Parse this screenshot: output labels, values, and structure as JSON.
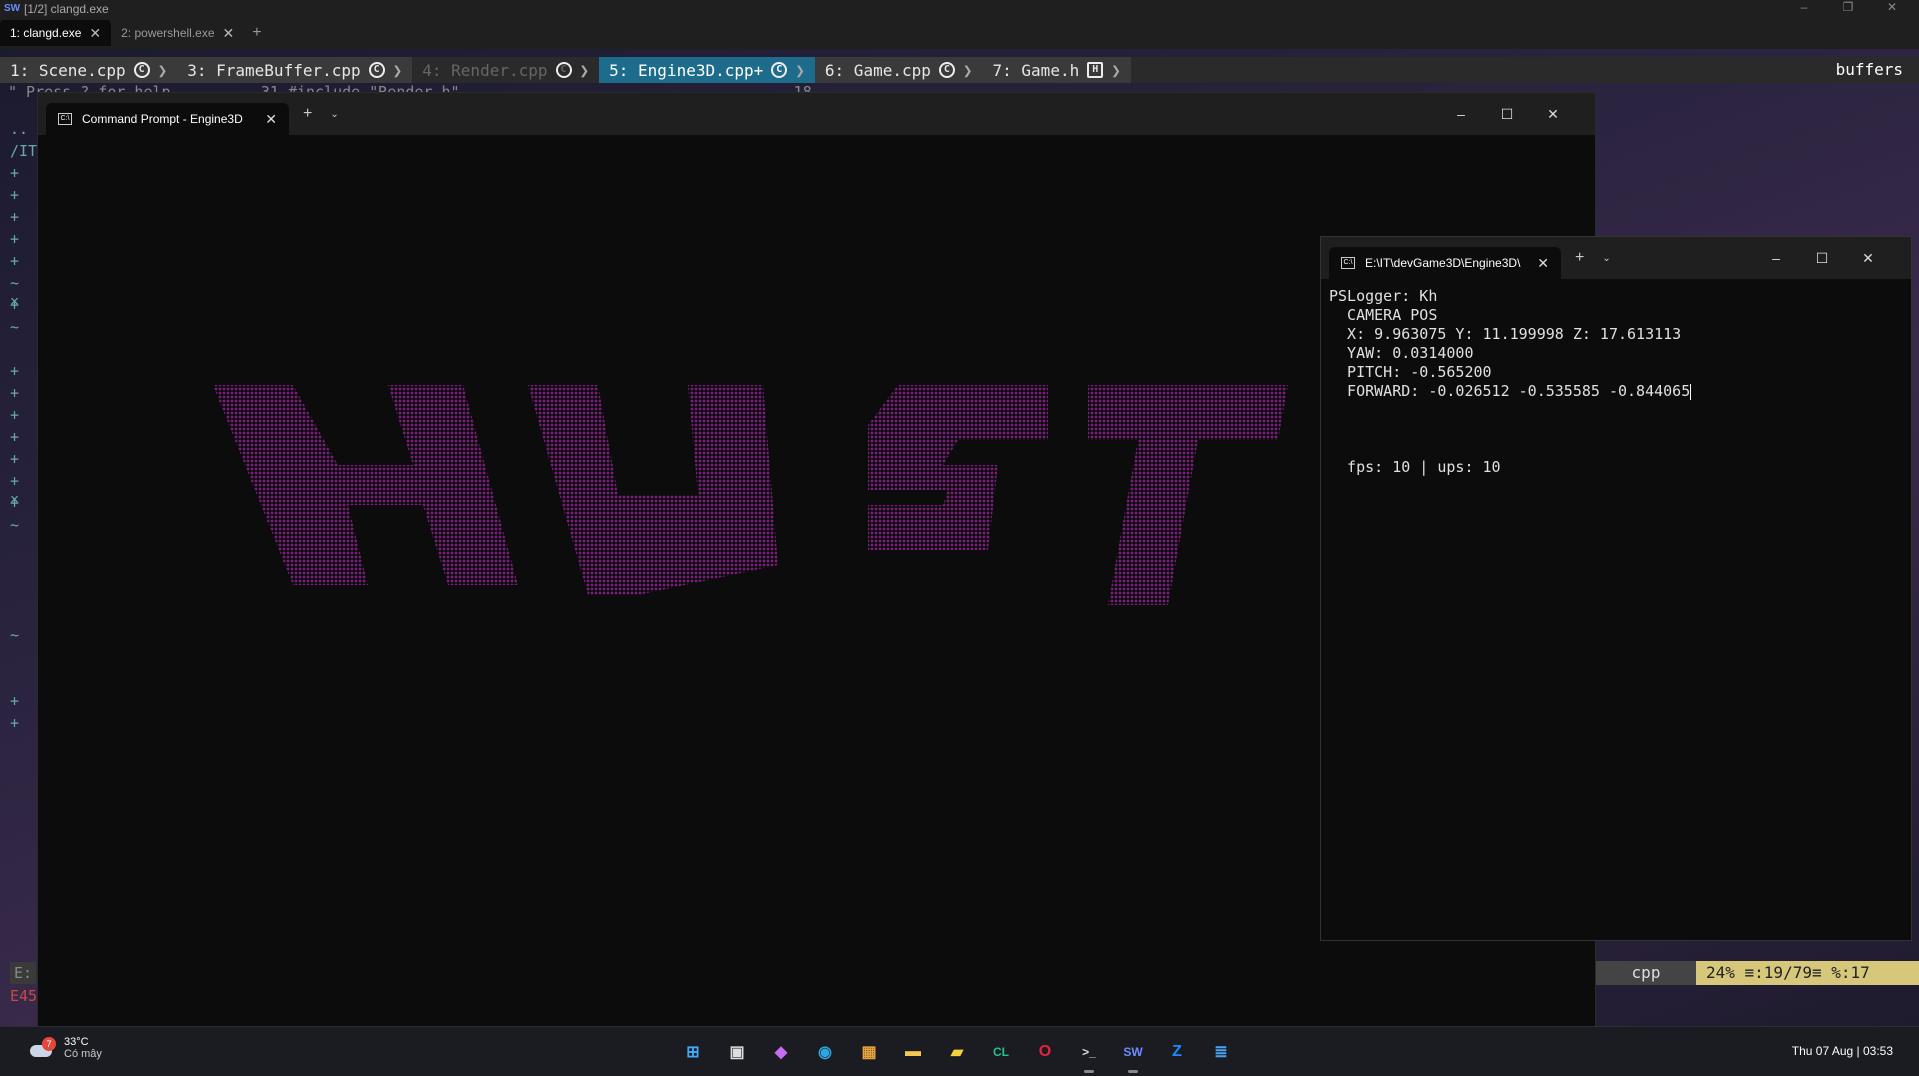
{
  "outer": {
    "title": "[1/2] clangd.exe",
    "tabs": [
      {
        "label": "1: clangd.exe",
        "active": true
      },
      {
        "label": "2: powershell.exe",
        "active": false
      }
    ]
  },
  "vim": {
    "tabs": [
      {
        "label": "1: Scene.cpp",
        "icon": "C",
        "state": "normal"
      },
      {
        "label": "3: FrameBuffer.cpp",
        "icon": "C",
        "state": "normal"
      },
      {
        "label": "4: Render.cpp",
        "icon": "C",
        "state": "dim"
      },
      {
        "label": "5: Engine3D.cpp+",
        "icon": "C",
        "state": "selected"
      },
      {
        "label": "6: Game.cpp",
        "icon": "C",
        "state": "normal"
      },
      {
        "label": "7: Game.h",
        "icon": "H",
        "state": "normal"
      }
    ],
    "buffers_label": "buffers",
    "bg_line": "\" Press ? for help          31 #include \"Render.h\"                                     18",
    "gutter": [
      "..",
      "/IT",
      "+",
      "+",
      "+",
      "+",
      "+",
      "~ ×",
      "  +",
      "  ~",
      "",
      "  +",
      "  +",
      "  +",
      "+",
      "+",
      "+ ×",
      "+",
      "~",
      "",
      "",
      "",
      "",
      "~",
      "",
      "",
      "+",
      "+"
    ],
    "status": {
      "filetype": "cpp",
      "position": "24% ≡:19/79≡ %:17"
    },
    "cmd1": "E:",
    "cmd2": "E45"
  },
  "cmd_window": {
    "tab_title": "Command Prompt - Engine3D",
    "art_color": "#7a1e7e",
    "art_text": "HUST"
  },
  "log_window": {
    "tab_title": "E:\\IT\\devGame3D\\Engine3D\\",
    "lines": [
      "PSLogger: Kh",
      "  CAMERA POS",
      "  X: 9.963075 Y: 11.199998 Z: 17.613113",
      "  YAW: 0.0314000",
      "  PITCH: -0.565200",
      "  FORWARD: -0.026512 -0.535585 -0.844065",
      "",
      "",
      "",
      "  fps: 10 | ups: 10"
    ]
  },
  "taskbar": {
    "weather_temp": "33°C",
    "weather_desc": "Có mây",
    "weather_badge": "7",
    "clock": "Thu 07 Aug | 03:53",
    "icons": [
      {
        "name": "start-icon",
        "glyph": "⊞",
        "color": "#3fa9f5"
      },
      {
        "name": "task-view-icon",
        "glyph": "▣",
        "color": "#ddd"
      },
      {
        "name": "copilot-icon",
        "glyph": "◆",
        "color": "#c56cf0"
      },
      {
        "name": "edge-icon",
        "glyph": "◉",
        "color": "#2fa6e0"
      },
      {
        "name": "store-icon",
        "glyph": "▦",
        "color": "#e8a33b"
      },
      {
        "name": "file-explorer-icon",
        "glyph": "▬",
        "color": "#f2c94c"
      },
      {
        "name": "sticky-notes-icon",
        "glyph": "▰",
        "color": "#f7d13b"
      },
      {
        "name": "clion-icon",
        "glyph": "CL",
        "color": "#25c28a"
      },
      {
        "name": "opera-icon",
        "glyph": "O",
        "color": "#e5233c"
      },
      {
        "name": "terminal-icon",
        "glyph": ">_",
        "color": "#ddd"
      },
      {
        "name": "sw-icon",
        "glyph": "SW",
        "color": "#6a8cff"
      },
      {
        "name": "zalo-icon",
        "glyph": "Z",
        "color": "#1b8cff"
      },
      {
        "name": "notepad-icon",
        "glyph": "≣",
        "color": "#4aa3f0"
      }
    ]
  }
}
